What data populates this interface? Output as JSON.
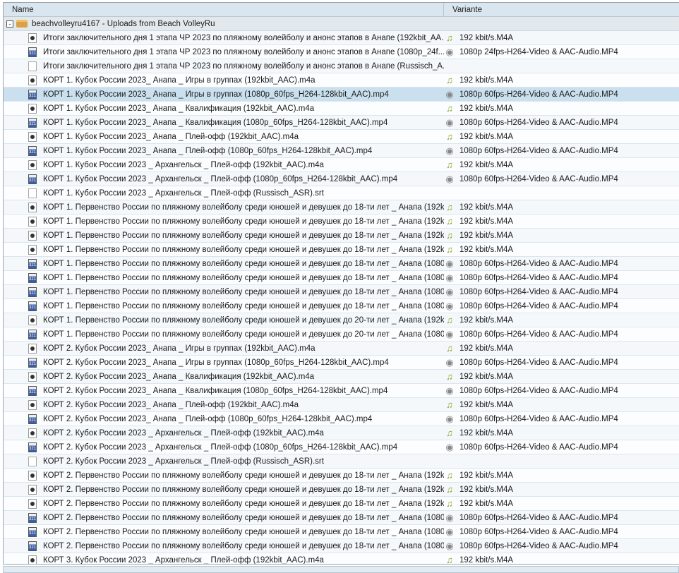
{
  "columns": {
    "name": "Name",
    "variant": "Variante"
  },
  "group": {
    "label": "beachvolleyru4167 - Uploads from Beach VolleyRu",
    "expander": "-"
  },
  "variants": {
    "audio": "192 kbit/s.M4A",
    "video60": "1080p 60fps-H264-Video & AAC-Audio.MP4",
    "video24": "1080p 24fps-H264-Video & AAC-Audio.MP4"
  },
  "rows": [
    {
      "name": "Итоги заключительного дня 1 этапа ЧР 2023 по пляжному волейболу и анонс этапов в Анапе (192kbit_AA..",
      "type": "audio",
      "variant": "192 kbit/s.M4A"
    },
    {
      "name": "Итоги заключительного дня 1 этапа ЧР 2023 по пляжному волейболу и анонс этапов в Анапе (1080p_24f...",
      "type": "video",
      "variant": "1080p 24fps-H264-Video & AAC-Audio.MP4"
    },
    {
      "name": "Итоги заключительного дня 1 этапа ЧР 2023 по пляжному волейболу и анонс этапов в Анапе (Russisch_A..",
      "type": "srt",
      "variant": ""
    },
    {
      "name": "КОРТ 1. Кубок России 2023_ Анапа _ Игры в группах (192kbit_AAC).m4a",
      "type": "audio",
      "variant": "192 kbit/s.M4A"
    },
    {
      "name": "КОРТ 1. Кубок России 2023_ Анапа _ Игры в группах (1080p_60fps_H264-128kbit_AAC).mp4",
      "type": "video",
      "variant": "1080p 60fps-H264-Video & AAC-Audio.MP4",
      "selected": true
    },
    {
      "name": "КОРТ 1. Кубок России 2023_ Анапа _ Квалификация (192kbit_AAC).m4a",
      "type": "audio",
      "variant": "192 kbit/s.M4A"
    },
    {
      "name": "КОРТ 1. Кубок России 2023_ Анапа _ Квалификация (1080p_60fps_H264-128kbit_AAC).mp4",
      "type": "video",
      "variant": "1080p 60fps-H264-Video & AAC-Audio.MP4"
    },
    {
      "name": "КОРТ 1. Кубок России 2023_ Анапа _ Плей-офф (192kbit_AAC).m4a",
      "type": "audio",
      "variant": "192 kbit/s.M4A"
    },
    {
      "name": "КОРТ 1. Кубок России 2023_ Анапа _ Плей-офф (1080p_60fps_H264-128kbit_AAC).mp4",
      "type": "video",
      "variant": "1080p 60fps-H264-Video & AAC-Audio.MP4"
    },
    {
      "name": "КОРТ 1. Кубок России 2023 _ Архангельск _ Плей-офф (192kbit_AAC).m4a",
      "type": "audio",
      "variant": "192 kbit/s.M4A"
    },
    {
      "name": "КОРТ 1. Кубок России 2023 _ Архангельск _ Плей-офф (1080p_60fps_H264-128kbit_AAC).mp4",
      "type": "video",
      "variant": "1080p 60fps-H264-Video & AAC-Audio.MP4"
    },
    {
      "name": "КОРТ 1. Кубок России 2023 _ Архангельск _ Плей-офф (Russisch_ASR).srt",
      "type": "srt",
      "variant": ""
    },
    {
      "name": "КОРТ 1. Первенство России по пляжному волейболу среди юношей и девушек до 18-ти лет _ Анапа (192k...",
      "type": "audio",
      "variant": "192 kbit/s.M4A"
    },
    {
      "name": "КОРТ 1. Первенство России по пляжному волейболу среди юношей и девушек до 18-ти лет _ Анапа (192k...",
      "type": "audio",
      "variant": "192 kbit/s.M4A"
    },
    {
      "name": "КОРТ 1. Первенство России по пляжному волейболу среди юношей и девушек до 18-ти лет _ Анапа (192k...",
      "type": "audio",
      "variant": "192 kbit/s.M4A"
    },
    {
      "name": "КОРТ 1. Первенство России по пляжному волейболу среди юношей и девушек до 18-ти лет _ Анапа (192k...",
      "type": "audio",
      "variant": "192 kbit/s.M4A"
    },
    {
      "name": "КОРТ 1. Первенство России по пляжному волейболу среди юношей и девушек до 18-ти лет _ Анапа (1080...",
      "type": "video",
      "variant": "1080p 60fps-H264-Video & AAC-Audio.MP4"
    },
    {
      "name": "КОРТ 1. Первенство России по пляжному волейболу среди юношей и девушек до 18-ти лет _ Анапа (1080...",
      "type": "video",
      "variant": "1080p 60fps-H264-Video & AAC-Audio.MP4"
    },
    {
      "name": "КОРТ 1. Первенство России по пляжному волейболу среди юношей и девушек до 18-ти лет _ Анапа (1080...",
      "type": "video",
      "variant": "1080p 60fps-H264-Video & AAC-Audio.MP4"
    },
    {
      "name": "КОРТ 1. Первенство России по пляжному волейболу среди юношей и девушек до 18-ти лет _ Анапа (1080...",
      "type": "video",
      "variant": "1080p 60fps-H264-Video & AAC-Audio.MP4"
    },
    {
      "name": "КОРТ 1. Первенство России по пляжному волейболу среди юношей и девушек до 20-ти лет _ Анапа (192k...",
      "type": "audio",
      "variant": "192 kbit/s.M4A"
    },
    {
      "name": "КОРТ 1. Первенство России по пляжному волейболу среди юношей и девушек до 20-ти лет _ Анапа (1080...",
      "type": "video",
      "variant": "1080p 60fps-H264-Video & AAC-Audio.MP4"
    },
    {
      "name": "КОРТ 2. Кубок России 2023_ Анапа _ Игры в группах (192kbit_AAC).m4a",
      "type": "audio",
      "variant": "192 kbit/s.M4A"
    },
    {
      "name": "КОРТ 2. Кубок России 2023_ Анапа _ Игры в группах (1080p_60fps_H264-128kbit_AAC).mp4",
      "type": "video",
      "variant": "1080p 60fps-H264-Video & AAC-Audio.MP4"
    },
    {
      "name": "КОРТ 2. Кубок России 2023_ Анапа _ Квалификация (192kbit_AAC).m4a",
      "type": "audio",
      "variant": "192 kbit/s.M4A"
    },
    {
      "name": "КОРТ 2. Кубок России 2023_ Анапа _ Квалификация (1080p_60fps_H264-128kbit_AAC).mp4",
      "type": "video",
      "variant": "1080p 60fps-H264-Video & AAC-Audio.MP4"
    },
    {
      "name": "КОРТ 2. Кубок России 2023_ Анапа _ Плей-офф (192kbit_AAC).m4a",
      "type": "audio",
      "variant": "192 kbit/s.M4A"
    },
    {
      "name": "КОРТ 2. Кубок России 2023_ Анапа _ Плей-офф (1080p_60fps_H264-128kbit_AAC).mp4",
      "type": "video",
      "variant": "1080p 60fps-H264-Video & AAC-Audio.MP4"
    },
    {
      "name": "КОРТ 2. Кубок России 2023 _ Архангельск _ Плей-офф (192kbit_AAC).m4a",
      "type": "audio",
      "variant": "192 kbit/s.M4A"
    },
    {
      "name": "КОРТ 2. Кубок России 2023 _ Архангельск _ Плей-офф (1080p_60fps_H264-128kbit_AAC).mp4",
      "type": "video",
      "variant": "1080p 60fps-H264-Video & AAC-Audio.MP4"
    },
    {
      "name": "КОРТ 2. Кубок России 2023 _ Архангельск _ Плей-офф (Russisch_ASR).srt",
      "type": "srt",
      "variant": ""
    },
    {
      "name": "КОРТ 2. Первенство России по пляжному волейболу среди юношей и девушек до 18-ти лет _ Анапа (192k...",
      "type": "audio",
      "variant": "192 kbit/s.M4A"
    },
    {
      "name": "КОРТ 2. Первенство России по пляжному волейболу среди юношей и девушек до 18-ти лет _ Анапа (192k...",
      "type": "audio",
      "variant": "192 kbit/s.M4A"
    },
    {
      "name": "КОРТ 2. Первенство России по пляжному волейболу среди юношей и девушек до 18-ти лет _ Анапа (192k...",
      "type": "audio",
      "variant": "192 kbit/s.M4A"
    },
    {
      "name": "КОРТ 2. Первенство России по пляжному волейболу среди юношей и девушек до 18-ти лет _ Анапа (1080...",
      "type": "video",
      "variant": "1080p 60fps-H264-Video & AAC-Audio.MP4"
    },
    {
      "name": "КОРТ 2. Первенство России по пляжному волейболу среди юношей и девушек до 18-ти лет _ Анапа (1080...",
      "type": "video",
      "variant": "1080p 60fps-H264-Video & AAC-Audio.MP4"
    },
    {
      "name": "КОРТ 2. Первенство России по пляжному волейболу среди юношей и девушек до 18-ти лет _ Анапа (1080...",
      "type": "video",
      "variant": "1080p 60fps-H264-Video & AAC-Audio.MP4"
    },
    {
      "name": "КОРТ 3. Кубок России 2023 _ Архангельск _ Плей-офф (192kbit_AAC).m4a",
      "type": "audio",
      "variant": "192 kbit/s.M4A"
    }
  ]
}
